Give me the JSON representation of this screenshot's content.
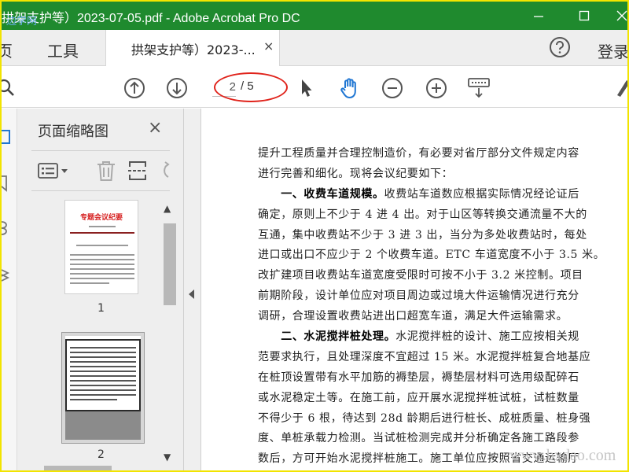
{
  "window": {
    "title": "拱架支护等）2023-07-05.pdf - Adobe Acrobat Pro DC",
    "watermark": "边学网",
    "colors": {
      "title_bar": "#1f8a2e",
      "accent": "#e0231b",
      "frame": "#f2e400"
    }
  },
  "tabs": {
    "home": "页",
    "tools": "工具",
    "document": "拱架支护等）2023-...",
    "document_close": "×",
    "login": "登录"
  },
  "toolbar": {
    "page_current": "2",
    "page_total": "/ 5",
    "icons": [
      "search-icon",
      "prev-page-icon",
      "next-page-icon",
      "select-cursor-icon",
      "hand-tool-icon",
      "zoom-out-icon",
      "zoom-in-icon",
      "keyboard-icon",
      "sign-icon"
    ]
  },
  "panel": {
    "title": "页面缩略图",
    "close": "×",
    "thumbnails": [
      {
        "label": "1",
        "heading": "专题会议纪要"
      },
      {
        "label": "2"
      }
    ]
  },
  "document": {
    "lines": [
      {
        "head": "",
        "text": "提升工程质量并合理控制造价，有必要对省厅部分文件规定内容"
      },
      {
        "head": "",
        "text": "进行完善和细化。现将会议纪要如下："
      },
      {
        "head": "　　一、收费车道规模。",
        "text": "收费站车道数应根据实际情况经论证后"
      },
      {
        "head": "",
        "text": "确定，原则上不少于 4 进 4 出。对于山区等转换交通流量不大的"
      },
      {
        "head": "",
        "text": "互通，集中收费站不少于 3 进 3 出，当分为多处收费站时，每处"
      },
      {
        "head": "",
        "text": "进口或出口不应少于 2 个收费车道。ETC 车道宽度不小于 3.5 米。"
      },
      {
        "head": "",
        "text": "改扩建项目收费站车道宽度受限时可按不小于 3.2 米控制。项目"
      },
      {
        "head": "",
        "text": "前期阶段，设计单位应对项目周边或过境大件运输情况进行充分"
      },
      {
        "head": "",
        "text": "调研，合理设置收费站进出口超宽车道，满足大件运输需求。"
      },
      {
        "head": "　　二、水泥搅拌桩处理。",
        "text": "水泥搅拌桩的设计、施工应按相关规"
      },
      {
        "head": "",
        "text": "范要求执行，且处理深度不宜超过 15 米。水泥搅拌桩复合地基应"
      },
      {
        "head": "",
        "text": "在桩顶设置带有水平加筋的褥垫层，褥垫层材料可选用级配碎石"
      },
      {
        "head": "",
        "text": "或水泥稳定土等。在施工前，应开展水泥搅拌桩试桩，试桩数量"
      },
      {
        "head": "",
        "text": "不得少于 6 根，待达到 28d 龄期后进行桩长、成桩质量、桩身强"
      },
      {
        "head": "",
        "text": "度、单桩承载力检测。当试桩检测完成并分析确定各施工路段参"
      },
      {
        "head": "",
        "text": "数后，方可开始水泥搅拌桩施工。施工单位应按照省交通运输厅"
      }
    ],
    "site_watermark": "www.bxdao.com"
  }
}
